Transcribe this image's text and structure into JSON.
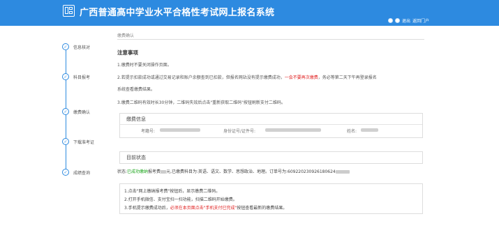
{
  "header": {
    "title": "广西普通高中学业水平合格性考试网上报名系统",
    "links": [
      "退出",
      "返回门户"
    ]
  },
  "sidebar": {
    "steps": [
      {
        "label": "信息核对",
        "state": "done"
      },
      {
        "label": "科目报考",
        "state": "done"
      },
      {
        "label": "缴费确认",
        "state": "done"
      },
      {
        "label": "下载准考证",
        "state": "done"
      },
      {
        "label": "成绩查询",
        "state": "done"
      }
    ]
  },
  "content": {
    "breadcrumb": "缴费确认",
    "notice_title": "注意事项",
    "notes": {
      "n1": "1.缴费时不要关闭操作页面。",
      "n2_a": "2.若提示扣款成功或通过交易记录和账户余额查到已扣款，但报名网站没有提示缴费成功，",
      "n2_red": "一会不要再次缴费",
      "n2_b": "，务必等第二天下午再登录报名",
      "n2_c": "系统查看缴费结果。",
      "n3": "3.缴费二维码有效时长30分钟，二维码失效后点击\"重新获取二维码\"按钮刷新支付二维码。"
    },
    "payment_info": {
      "title": "缴费信息",
      "exam_no_label": "考籍号:",
      "id_label": "身份证号/证件号:",
      "name_label": "姓名:"
    },
    "status": {
      "title": "目前状态",
      "prefix": "状态:",
      "state": "已成功缴纳",
      "text_a": "报考费",
      "text_b": "元,已缴费科目为:英语、语文、数学、思想政治、地理。订单号为:609220230926180624"
    },
    "tips": {
      "t1": "1.点击\"网上缴纳报考费\"按钮后，显示缴费二维码。",
      "t2": "2.打开手机微信、支付宝扫一扫功能，扫描二维码开始缴费。",
      "t3_a": "3.手机提示缴费成功后，",
      "t3_red": "必须在本页面点击\"手机支付已完成\"",
      "t3_b": "按钮查看最新的缴费结果。"
    }
  },
  "colors": {
    "brand": "#2d8ae0",
    "alert": "#e02020",
    "success": "#19a419"
  }
}
